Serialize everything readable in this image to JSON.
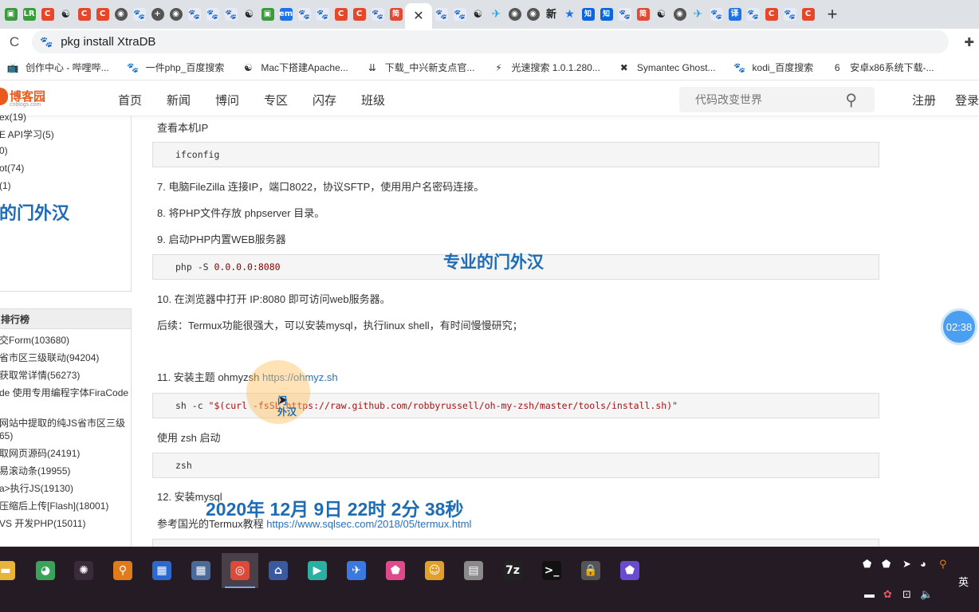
{
  "browser": {
    "tabs": [
      {
        "icon": "green-app-icon",
        "glyph": "▣",
        "cls": "fav-green"
      },
      {
        "icon": "lr-icon",
        "glyph": "LR",
        "cls": "fav-green"
      },
      {
        "icon": "csdn-icon",
        "glyph": "C",
        "cls": "fav-red"
      },
      {
        "icon": "mac-icon",
        "glyph": "☯",
        "cls": "fav-mac"
      },
      {
        "icon": "csdn-icon",
        "glyph": "C",
        "cls": "fav-red"
      },
      {
        "icon": "csdn-icon",
        "glyph": "C",
        "cls": "fav-red"
      },
      {
        "icon": "globe-icon",
        "glyph": "◉",
        "cls": "fav-dark"
      },
      {
        "icon": "baidu-paw-icon",
        "glyph": "🐾",
        "cls": "fav-paw"
      },
      {
        "icon": "plus-app-icon",
        "glyph": "+",
        "cls": "fav-dark"
      },
      {
        "icon": "globe-icon",
        "glyph": "◉",
        "cls": "fav-dark"
      },
      {
        "icon": "baidu-paw-icon",
        "glyph": "🐾",
        "cls": "fav-paw"
      },
      {
        "icon": "baidu-paw-icon",
        "glyph": "🐾",
        "cls": "fav-paw"
      },
      {
        "icon": "baidu-paw-icon",
        "glyph": "🐾",
        "cls": "fav-paw"
      },
      {
        "icon": "mac-icon",
        "glyph": "☯",
        "cls": "fav-mac"
      },
      {
        "icon": "green-app-icon",
        "glyph": "▣",
        "cls": "fav-green"
      },
      {
        "icon": "em-icon",
        "glyph": "em",
        "cls": "fav-blue"
      },
      {
        "icon": "baidu-paw-icon",
        "glyph": "🐾",
        "cls": "fav-paw"
      },
      {
        "icon": "baidu-paw-icon",
        "glyph": "🐾",
        "cls": "fav-paw"
      },
      {
        "icon": "csdn-icon",
        "glyph": "C",
        "cls": "fav-red"
      },
      {
        "icon": "csdn-icon",
        "glyph": "C",
        "cls": "fav-red"
      },
      {
        "icon": "baidu-paw-icon",
        "glyph": "🐾",
        "cls": "fav-paw"
      },
      {
        "icon": "jianshu-icon",
        "glyph": "简",
        "cls": "fav-jian"
      },
      {
        "icon": "active-tab-close-icon",
        "glyph": "✕",
        "cls": "active"
      },
      {
        "icon": "baidu-paw-icon",
        "glyph": "🐾",
        "cls": "fav-paw"
      },
      {
        "icon": "baidu-paw-icon",
        "glyph": "🐾",
        "cls": "fav-paw"
      },
      {
        "icon": "mac-icon",
        "glyph": "☯",
        "cls": "fav-mac"
      },
      {
        "icon": "bird-icon",
        "glyph": "✈",
        "cls": "fav-bird"
      },
      {
        "icon": "globe-icon",
        "glyph": "◉",
        "cls": "fav-dark"
      },
      {
        "icon": "globe-icon",
        "glyph": "◉",
        "cls": "fav-dark"
      },
      {
        "icon": "xin-icon",
        "glyph": "新",
        "cls": "fav-mac"
      },
      {
        "icon": "star-icon",
        "glyph": "★",
        "cls": "fav-star"
      },
      {
        "icon": "zhihu-icon",
        "glyph": "知",
        "cls": "fav-zhi"
      },
      {
        "icon": "zhihu-icon",
        "glyph": "知",
        "cls": "fav-zhi"
      },
      {
        "icon": "baidu-paw-icon",
        "glyph": "🐾",
        "cls": "fav-paw"
      },
      {
        "icon": "jianshu-icon",
        "glyph": "简",
        "cls": "fav-jian"
      },
      {
        "icon": "mac-icon",
        "glyph": "☯",
        "cls": "fav-mac"
      },
      {
        "icon": "globe-icon",
        "glyph": "◉",
        "cls": "fav-dark"
      },
      {
        "icon": "bird-icon",
        "glyph": "✈",
        "cls": "fav-bird"
      },
      {
        "icon": "baidu-paw-icon",
        "glyph": "🐾",
        "cls": "fav-paw"
      },
      {
        "icon": "translate-icon",
        "glyph": "译",
        "cls": "fav-blue"
      },
      {
        "icon": "baidu-paw-icon",
        "glyph": "🐾",
        "cls": "fav-paw"
      },
      {
        "icon": "csdn-icon",
        "glyph": "C",
        "cls": "fav-red"
      },
      {
        "icon": "baidu-paw-icon",
        "glyph": "🐾",
        "cls": "fav-paw"
      },
      {
        "icon": "csdn-icon",
        "glyph": "C",
        "cls": "fav-red"
      }
    ],
    "new_tab_glyph": "+",
    "reload_glyph": "C",
    "address": "pkg install XtraDB",
    "bookmarks": [
      {
        "icon": "tv-icon",
        "glyph": "📺",
        "label": "创作中心 - 哔哩哔..."
      },
      {
        "icon": "baidu-paw-icon",
        "glyph": "🐾",
        "label": "一件php_百度搜索"
      },
      {
        "icon": "mac-icon",
        "glyph": "☯",
        "label": "Mac下搭建Apache..."
      },
      {
        "icon": "download-icon",
        "glyph": "⇊",
        "label": "下载_中兴新支点官..."
      },
      {
        "icon": "lightspeed-icon",
        "glyph": "⚡",
        "label": "光速搜索 1.0.1.280..."
      },
      {
        "icon": "symantec-icon",
        "glyph": "✖",
        "label": "Symantec Ghost..."
      },
      {
        "icon": "baidu-paw-icon",
        "glyph": "🐾",
        "label": "kodi_百度搜索"
      },
      {
        "icon": "android-icon",
        "glyph": "6",
        "label": "安卓x86系统下载-..."
      }
    ]
  },
  "site": {
    "logo_text": "博客园",
    "logo_sub": "cnblogs.com",
    "nav": [
      "首页",
      "新闻",
      "博问",
      "专区",
      "闪存",
      "班级"
    ],
    "search_placeholder": "代码改变世界",
    "register": "注册",
    "login": "登录"
  },
  "sidebar": {
    "top_lines": [
      "ex(19)",
      "E API学习(5)",
      "0)",
      "ot(74)",
      "(1)"
    ],
    "watermark": "的门外汉",
    "ranking_title": "排行榜",
    "ranking": [
      "交Form(103680)",
      "省市区三级联动(94204)",
      "获取常详情(56273)",
      "de 使用专用编程字体FiraCode",
      "网站中提取的纯JS省市区三级",
      "65)",
      "取网页源码(24191)",
      "易滚动条(19955)",
      "a>执行JS(19130)",
      "压缩后上传[Flash](18001)",
      "VS 开发PHP(15011)"
    ]
  },
  "article": {
    "p_check_ip": "查看本机IP",
    "code_ifconfig": "ifconfig",
    "p7": "7. 电脑FileZilla 连接IP，端口8022，协议SFTP，使用用户名密码连接。",
    "p8": "8. 将PHP文件存放 phpserver 目录。",
    "p9": "9. 启动PHP内置WEB服务器",
    "code_php_cmd": "php -S ",
    "code_php_addr": "0.0.0.0:8080",
    "p10": "10. 在浏览器中打开 IP:8080 即可访问web服务器。",
    "p_followup": "后续：Termux功能很强大，可以安装mysql，执行linux shell，有时间慢慢研究；",
    "p11_text": "11. 安装主题 ohmyzsh ",
    "p11_link": "https://ohmyz.sh",
    "code_sh_prefix": "sh -c ",
    "code_sh_str": "\"$(curl -fsSL https://raw.github.com/robbyrussell/oh-my-zsh/master/tools/install.sh)\"",
    "p_zsh": "使用 zsh 启动",
    "code_zsh": "zsh",
    "p12": "12. 安装mysql",
    "p_ref_text": "参考国光的Termux教程 ",
    "p_ref_link": "https://www.sqlsec.com/2018/05/termux.html"
  },
  "overlay": {
    "watermark_center": "专业的门外汉",
    "timestamp": "2020年 12月 9日 22时 2分 38秒",
    "cursor_label": "门\n外汉",
    "timer": "02:38"
  },
  "taskbar": {
    "apps": [
      {
        "icon": "file-explorer-icon",
        "glyph": "▬",
        "color": "#e8b43a"
      },
      {
        "icon": "network-globe-icon",
        "glyph": "◕",
        "color": "#3aa35a"
      },
      {
        "icon": "media-player-icon",
        "glyph": "✺",
        "color": "#3a2a3a"
      },
      {
        "icon": "search-tool-icon",
        "glyph": "⚲",
        "color": "#e07a1a"
      },
      {
        "icon": "window-app-icon",
        "glyph": "▦",
        "color": "#2a6ad0"
      },
      {
        "icon": "window-app-icon",
        "glyph": "▦",
        "color": "#4a6a9a"
      },
      {
        "icon": "chrome-icon",
        "glyph": "◎",
        "color": "#d94a38"
      },
      {
        "icon": "network-app-icon",
        "glyph": "⌂",
        "color": "#3a5aa0"
      },
      {
        "icon": "video-player-icon",
        "glyph": "▶",
        "color": "#2ab0a0"
      },
      {
        "icon": "feishu-icon",
        "glyph": "✈",
        "color": "#3a7ae0"
      },
      {
        "icon": "colorful-app-icon",
        "glyph": "⬟",
        "color": "#e04a8a"
      },
      {
        "icon": "ftp-icon",
        "glyph": "☺",
        "color": "#e0a02a"
      },
      {
        "icon": "monitor-app-icon",
        "glyph": "▤",
        "color": "#8a8a8a"
      },
      {
        "icon": "7zip-icon",
        "glyph": "7z",
        "color": "#222222"
      },
      {
        "icon": "terminal-icon",
        "glyph": ">_",
        "color": "#111111"
      },
      {
        "icon": "lock-app-icon",
        "glyph": "🔒",
        "color": "#555555"
      },
      {
        "icon": "colorful-app-icon",
        "glyph": "⬟",
        "color": "#6a4ad0"
      }
    ],
    "ime": "英"
  }
}
